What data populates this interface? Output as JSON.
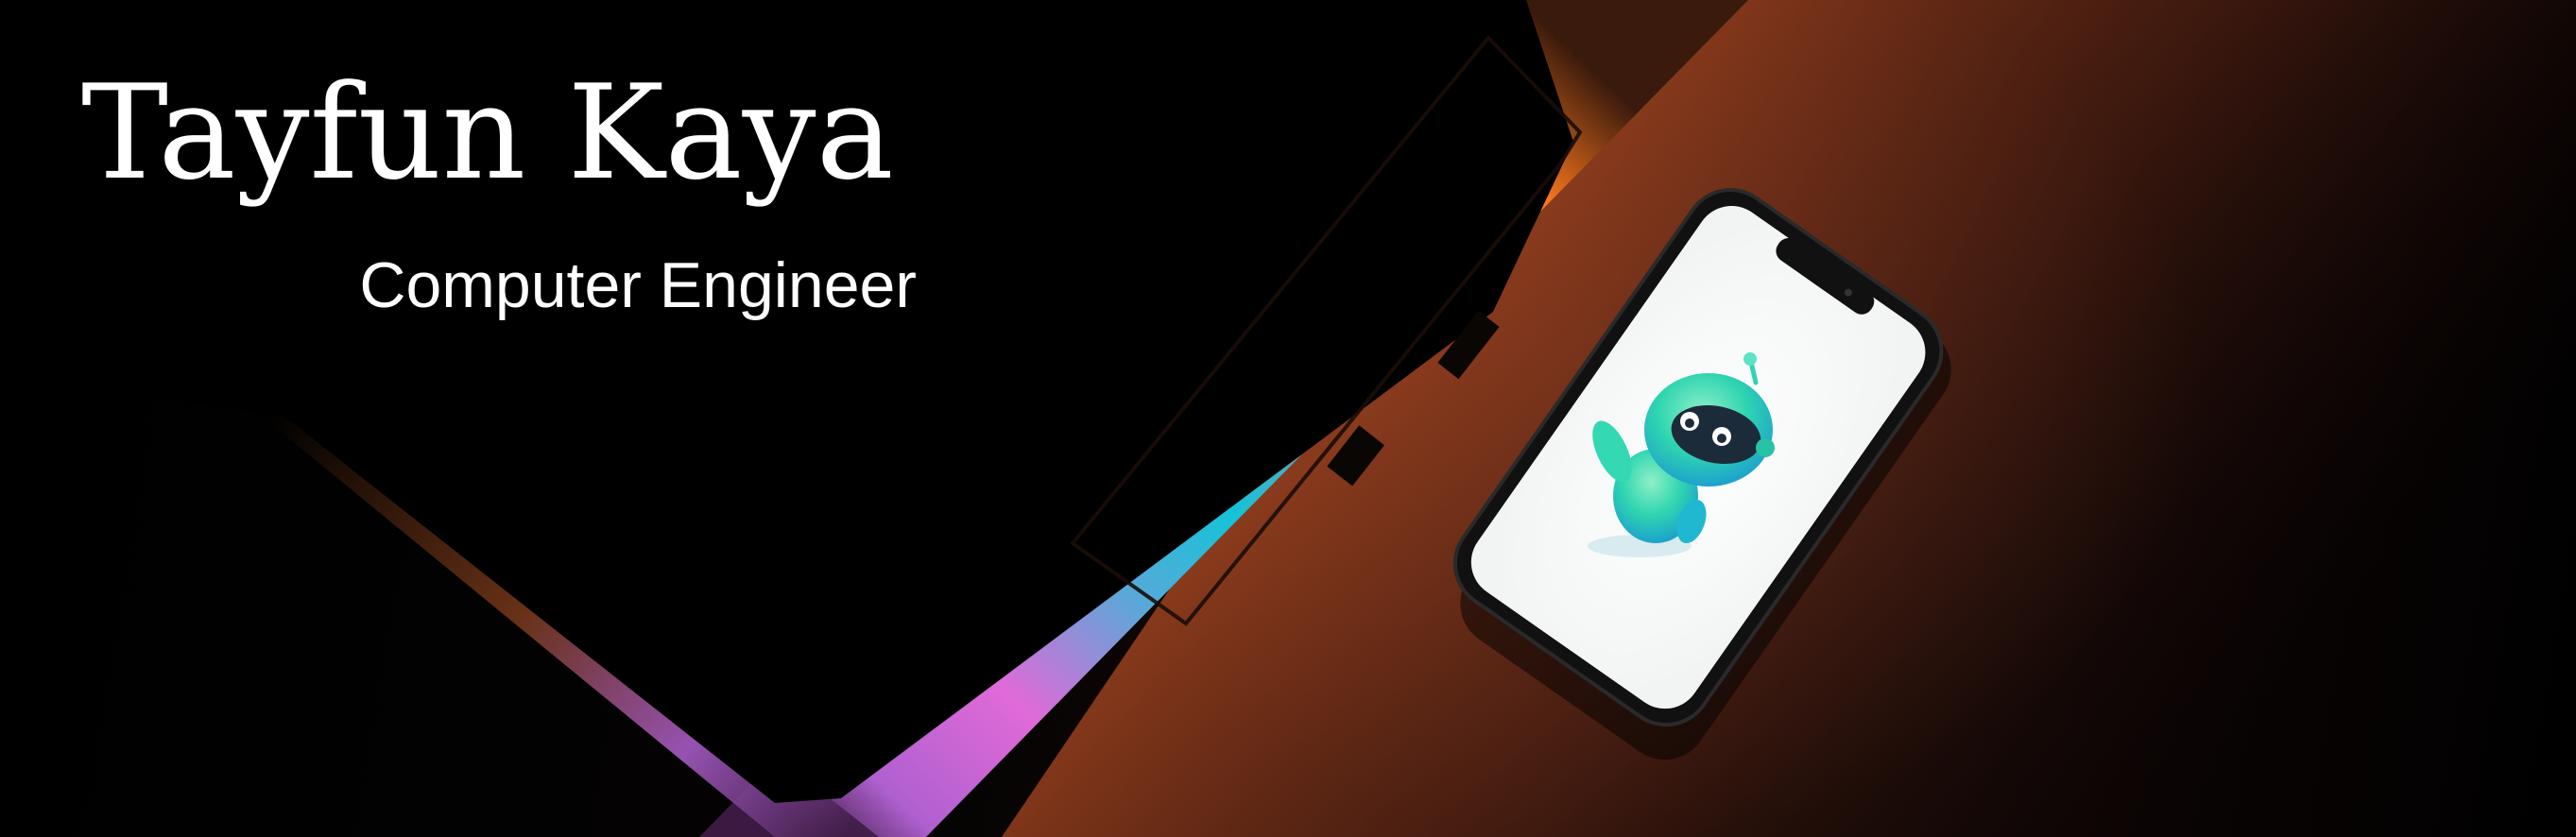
{
  "header": {
    "name": "Tayfun Kaya",
    "role": "Computer Engineer"
  },
  "illustration": {
    "laptop": "laptop-corner",
    "phone": "smartphone",
    "mascot": "robot-mascot-icon"
  },
  "colors": {
    "background": "#000000",
    "text": "#ffffff",
    "glow_orange": "#ff7a1e",
    "glow_cyan": "#14c3d8",
    "glow_pink": "#e06ad8",
    "robot_teal": "#29d6b0",
    "robot_face": "#1c2b3a"
  }
}
